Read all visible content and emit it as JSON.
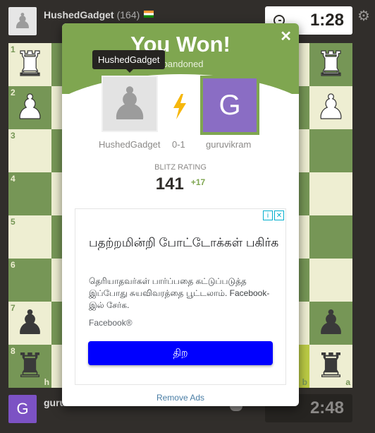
{
  "top_player": {
    "name": "HushedGadget",
    "rating": "(164)"
  },
  "top_clock": "1:28",
  "bottom_player": {
    "initial": "G",
    "name": "guru"
  },
  "bottom_clock": "2:48",
  "board": {
    "ranks": [
      "1",
      "2",
      "3",
      "4",
      "5",
      "6",
      "7",
      "8"
    ],
    "file_labels": {
      "a": "a",
      "b": "b",
      "h": "h"
    },
    "pieces": {
      "rook": "♜",
      "pawn": "♟"
    }
  },
  "modal": {
    "title": "You Won!",
    "subtitle": "abandoned",
    "tooltip": "HushedGadget",
    "player1_name": "HushedGadget",
    "score": "0-1",
    "player2_name": "guruvikram",
    "player2_initial": "G",
    "rating_label": "BLITZ RATING",
    "rating_value": "141",
    "rating_delta": "+17",
    "remove_ads": "Remove Ads"
  },
  "ad": {
    "headline": "பதற்றமின்றி போட்டோக்கள் பகிர்க",
    "body": "தெரியாதவர்கள் பார்ப்பதை கட்டுப்படுத்த இப்போது சுயவிவரத்தை பூட்டலாம். Facebook-இல் சேர்க.",
    "source": "Facebook®",
    "button": "திற",
    "info": "i",
    "close": "✕"
  },
  "colors": {
    "green": "#7fa650",
    "board_light": "#eeeed2",
    "board_dark": "#769656",
    "avatar_purple": "#8a6dc4",
    "ad_button": "#0000ff"
  }
}
